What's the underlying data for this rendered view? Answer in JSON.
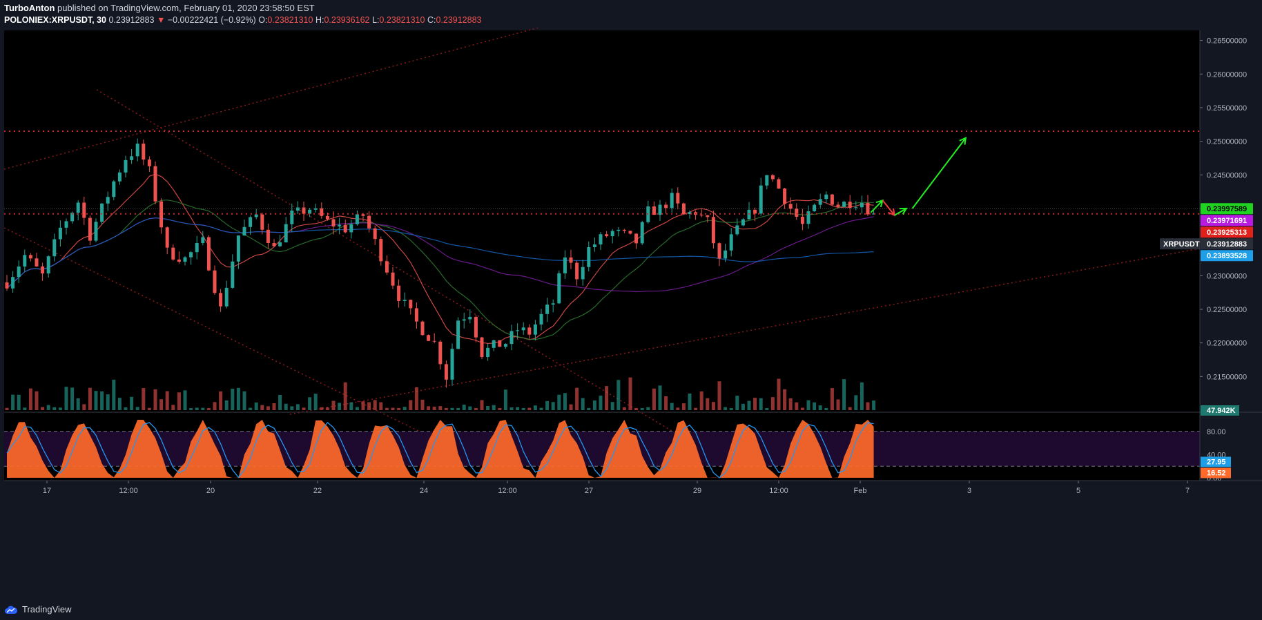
{
  "header": {
    "author": "TurboAnton",
    "published": " published on TradingView.com, February 01, 2020 23:58:50 EST",
    "symbol": "POLONIEX:XRPUSDT, 30",
    "last": "0.23912883",
    "change": "−0.00222421 (−0.92%)",
    "o_label": "O:",
    "o": "0.23821310",
    "h_label": "H:",
    "h": "0.23936162",
    "l_label": "L:",
    "l": "0.23821310",
    "c_label": "C:",
    "c": "0.23912883"
  },
  "footer": {
    "brand": "TradingView"
  },
  "colors": {
    "background": "#000000",
    "frame": "#131722",
    "up": "#26a69a",
    "down": "#ef5350",
    "stoch": "#ff6a2a",
    "stoch_band": "#1e0a2e"
  },
  "chart_data": {
    "type": "candlestick",
    "price_axis": {
      "ticks": [
        "0.26500000",
        "0.26000000",
        "0.25500000",
        "0.25000000",
        "0.24500000",
        "0.24000000",
        "0.23500000",
        "0.23000000",
        "0.22500000",
        "0.22000000",
        "0.21500000"
      ],
      "ylim": [
        0.21,
        0.2665
      ],
      "badges": [
        {
          "text": "0.23997589",
          "value": 0.23997589,
          "color": "#21d321",
          "textcolor": "#000000"
        },
        {
          "text": "0.23971691",
          "value": 0.23971691,
          "color": "#b91ae0",
          "textcolor": "#ffffff"
        },
        {
          "text": "0.23925313",
          "value": 0.23925313,
          "color": "#e0201b",
          "textcolor": "#ffffff"
        },
        {
          "text": "0.23912883",
          "value": 0.23912883,
          "color": "#2a2e39",
          "textcolor": "#ffffff"
        },
        {
          "text": "0.23893528",
          "value": 0.23893528,
          "color": "#1e9fe8",
          "textcolor": "#ffffff"
        }
      ],
      "symbol_tag": "XRPUSDT",
      "volume_badge": "47.942K"
    },
    "time_axis": {
      "ticks": [
        "17",
        "12:00",
        "20",
        "22",
        "24",
        "12:00",
        "27",
        "29",
        "12:00",
        "Feb",
        "3",
        "5",
        "7"
      ]
    },
    "price_path": [
      [
        0,
        0.229
      ],
      [
        3,
        0.233
      ],
      [
        6,
        0.23
      ],
      [
        9,
        0.237
      ],
      [
        12,
        0.241
      ],
      [
        14,
        0.236
      ],
      [
        16,
        0.24
      ],
      [
        18,
        0.244
      ],
      [
        20,
        0.2475
      ],
      [
        22,
        0.249
      ],
      [
        24,
        0.2455
      ],
      [
        27,
        0.2335
      ],
      [
        30,
        0.2325
      ],
      [
        33,
        0.235
      ],
      [
        36,
        0.225
      ],
      [
        39,
        0.236
      ],
      [
        42,
        0.239
      ],
      [
        45,
        0.234
      ],
      [
        48,
        0.239
      ],
      [
        51,
        0.24
      ],
      [
        54,
        0.238
      ],
      [
        57,
        0.237
      ],
      [
        60,
        0.239
      ],
      [
        63,
        0.233
      ],
      [
        66,
        0.227
      ],
      [
        69,
        0.223
      ],
      [
        72,
        0.22
      ],
      [
        74,
        0.215
      ],
      [
        76,
        0.2235
      ],
      [
        78,
        0.2245
      ],
      [
        80,
        0.2185
      ],
      [
        82,
        0.2195
      ],
      [
        84,
        0.22
      ],
      [
        86,
        0.222
      ],
      [
        88,
        0.2215
      ],
      [
        90,
        0.224
      ],
      [
        92,
        0.226
      ],
      [
        94,
        0.233
      ],
      [
        96,
        0.23
      ],
      [
        98,
        0.234
      ],
      [
        100,
        0.2355
      ],
      [
        102,
        0.2365
      ],
      [
        104,
        0.236
      ],
      [
        106,
        0.235
      ],
      [
        108,
        0.2395
      ],
      [
        110,
        0.24
      ],
      [
        112,
        0.2415
      ],
      [
        114,
        0.239
      ],
      [
        116,
        0.2395
      ],
      [
        118,
        0.238
      ],
      [
        120,
        0.232
      ],
      [
        122,
        0.2355
      ],
      [
        124,
        0.238
      ],
      [
        126,
        0.24
      ],
      [
        128,
        0.2455
      ],
      [
        130,
        0.243
      ],
      [
        132,
        0.24
      ],
      [
        134,
        0.2375
      ],
      [
        136,
        0.24
      ],
      [
        138,
        0.242
      ],
      [
        140,
        0.2405
      ],
      [
        142,
        0.241
      ],
      [
        144,
        0.241
      ],
      [
        146,
        0.239
      ]
    ],
    "annotations": {
      "horizontal_levels": [
        0.2515,
        0.2392
      ],
      "arrows": [
        {
          "type": "up",
          "from": [
            145.5,
            0.2394
          ],
          "to": [
            147.5,
            0.2412
          ]
        },
        {
          "type": "down",
          "from": [
            147.5,
            0.2412
          ],
          "to": [
            149.5,
            0.239
          ]
        },
        {
          "type": "up",
          "from": [
            149.5,
            0.239
          ],
          "to": [
            151.5,
            0.24
          ]
        },
        {
          "type": "up",
          "from": [
            152.5,
            0.24
          ],
          "to": [
            161.5,
            0.2505
          ]
        }
      ]
    },
    "stoch_axis": {
      "ticks": [
        "80.00",
        "40.00",
        "0.00"
      ],
      "badges": [
        {
          "text": "27.95",
          "value": 27.95,
          "color": "#1e9fe8"
        },
        {
          "text": "16.52",
          "value": 16.52,
          "color": "#ff6a2a"
        }
      ]
    }
  }
}
